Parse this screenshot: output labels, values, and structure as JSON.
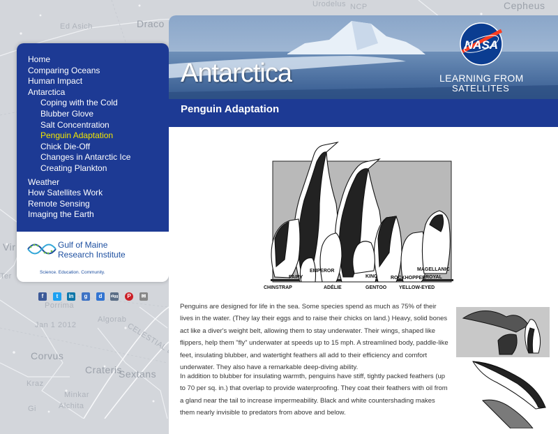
{
  "background": {
    "constellations": [
      "Ed Asich",
      "Draco",
      "Urodelus",
      "NCP",
      "Cepheus",
      "Vir",
      "Jan 1 2012",
      "Corvus",
      "Crateris",
      "Sextans",
      "Kraz",
      "Minkar",
      "Alchita",
      "CELESTIAL E",
      "Porrima",
      "Algorab",
      "Gi",
      "Ter"
    ]
  },
  "nav": {
    "items": [
      {
        "label": "Home",
        "level": 0,
        "active": false
      },
      {
        "label": "Comparing Oceans",
        "level": 0,
        "active": false
      },
      {
        "label": "Human Impact",
        "level": 0,
        "active": false
      },
      {
        "label": "Antarctica",
        "level": 0,
        "active": false
      },
      {
        "label": "Coping with the Cold",
        "level": 1,
        "active": false
      },
      {
        "label": "Blubber Glove",
        "level": 1,
        "active": false
      },
      {
        "label": "Salt Concentration",
        "level": 1,
        "active": false
      },
      {
        "label": "Penguin Adaptation",
        "level": 1,
        "active": true
      },
      {
        "label": "Chick Die-Off",
        "level": 1,
        "active": false
      },
      {
        "label": "Changes in Antarctic Ice",
        "level": 1,
        "active": false
      },
      {
        "label": "Creating Plankton",
        "level": 1,
        "active": false
      },
      {
        "label": "Weather",
        "level": 0,
        "active": false
      },
      {
        "label": "How Satellites Work",
        "level": 0,
        "active": false
      },
      {
        "label": "Remote Sensing",
        "level": 0,
        "active": false
      },
      {
        "label": "Imaging the Earth",
        "level": 0,
        "active": false
      }
    ]
  },
  "gmri": {
    "line1": "Gulf of Maine",
    "line2": "Research Institute",
    "tagline": "Science. Education. Community."
  },
  "share": {
    "icons": [
      {
        "name": "facebook-icon",
        "glyph": "f",
        "color": "#3b5998"
      },
      {
        "name": "twitter-icon",
        "glyph": "t",
        "color": "#1da1f2"
      },
      {
        "name": "linkedin-icon",
        "glyph": "in",
        "color": "#0e76a8"
      },
      {
        "name": "googleplus-icon",
        "glyph": "g",
        "color": "#3d72c4"
      },
      {
        "name": "delicious-icon",
        "glyph": "d",
        "color": "#3274d1"
      },
      {
        "name": "digg-icon",
        "glyph": "digg",
        "color": "#5b6e86"
      },
      {
        "name": "pinterest-icon",
        "glyph": "P",
        "color": "#cb2027"
      },
      {
        "name": "email-icon",
        "glyph": "✉",
        "color": "#888888"
      }
    ]
  },
  "header": {
    "title": "Antarctica",
    "nasa_logo": "NASA",
    "learning_line1": "LEARNING FROM",
    "learning_line2": "SATELLITES",
    "section_title": "Penguin Adaptation"
  },
  "illustration": {
    "labels": [
      "EMPEROR",
      "KING",
      "MAGELLANIC",
      "FAIRY",
      "ROCKHOPPER",
      "ROYAL",
      "CHINSTRAP",
      "ADÉLIE",
      "GENTOO",
      "YELLOW-EYED"
    ]
  },
  "content": {
    "paragraph1": "Penguins are designed for life in the sea. Some species spend as much as 75% of their lives in the water. (They lay their eggs and to raise their chicks on land.) Heavy, solid bones act like a diver's weight belt, allowing them to stay underwater. Their wings, shaped like flippers, help them \"fly\" underwater at speeds up to 15 mph. A streamlined body, paddle-like feet, insulating blubber, and watertight feathers all add to their efficiency and comfort underwater. They also have a remarkable deep-diving ability.",
    "paragraph2": "In addition to blubber for insulating warmth, penguins have stiff, tightly packed feathers (up to 70 per sq. in.) that overlap to provide waterproofing. They coat their feathers with oil from a gland near the tail to increase impermeability. Black and white countershading makes them nearly invisible to predators from above and below."
  },
  "colors": {
    "nav_blue": "#1d3a94",
    "active_link": "#f2e600",
    "background": "#d3d6db"
  }
}
